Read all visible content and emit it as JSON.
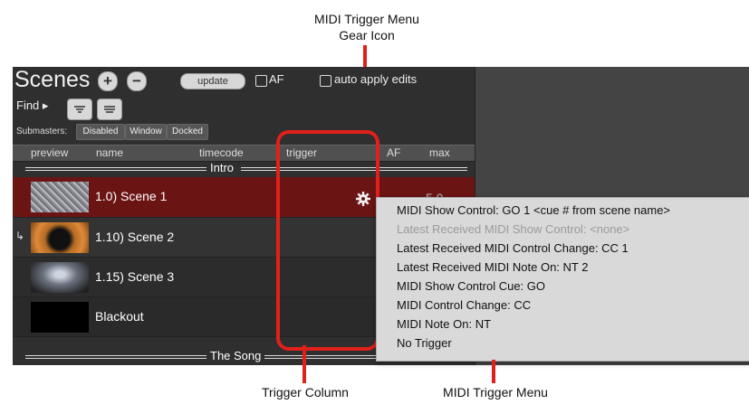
{
  "annotations": {
    "gear_callout_line1": "MIDI Trigger Menu",
    "gear_callout_line2": "Gear Icon",
    "trigger_column_callout": "Trigger Column",
    "menu_callout": "MIDI Trigger Menu"
  },
  "panel": {
    "title": "Scenes",
    "add_label": "+",
    "remove_label": "−",
    "update_label": "update",
    "af_label": "AF",
    "auto_apply_label": "auto apply edits",
    "find_label": "Find ▸",
    "submasters_label": "Submasters:",
    "submaster_buttons": [
      "Disabled",
      "Window",
      "Docked"
    ]
  },
  "columns": [
    "preview",
    "name",
    "timecode",
    "trigger",
    "AF",
    "max"
  ],
  "groups": [
    "Intro",
    "The Song"
  ],
  "scenes": [
    {
      "name": "1.0) Scene 1",
      "trailing": "5.0"
    },
    {
      "name": "1.10) Scene 2",
      "link_marker": "↳"
    },
    {
      "name": "1.15) Scene 3"
    },
    {
      "name": "Blackout"
    }
  ],
  "trigger_menu": {
    "items": [
      {
        "label": "MIDI Show Control: GO 1 <cue # from scene name>",
        "enabled": true
      },
      {
        "label": "Latest Received MIDI Show Control: <none>",
        "enabled": false
      },
      {
        "label": "Latest Received MIDI Control Change: CC 1",
        "enabled": true
      },
      {
        "label": "Latest Received MIDI Note On: NT 2",
        "enabled": true
      },
      {
        "label": "MIDI Show Control Cue: GO",
        "enabled": true
      },
      {
        "label": "MIDI Control Change: CC",
        "enabled": true
      },
      {
        "label": "MIDI Note On: NT",
        "enabled": true
      },
      {
        "label": "No Trigger",
        "enabled": true
      }
    ]
  },
  "colors": {
    "accent_red": "#e0201b",
    "selected_row": "#6b1414",
    "panel_bg": "#2f2f2f",
    "menu_bg": "#d9d9d9"
  }
}
